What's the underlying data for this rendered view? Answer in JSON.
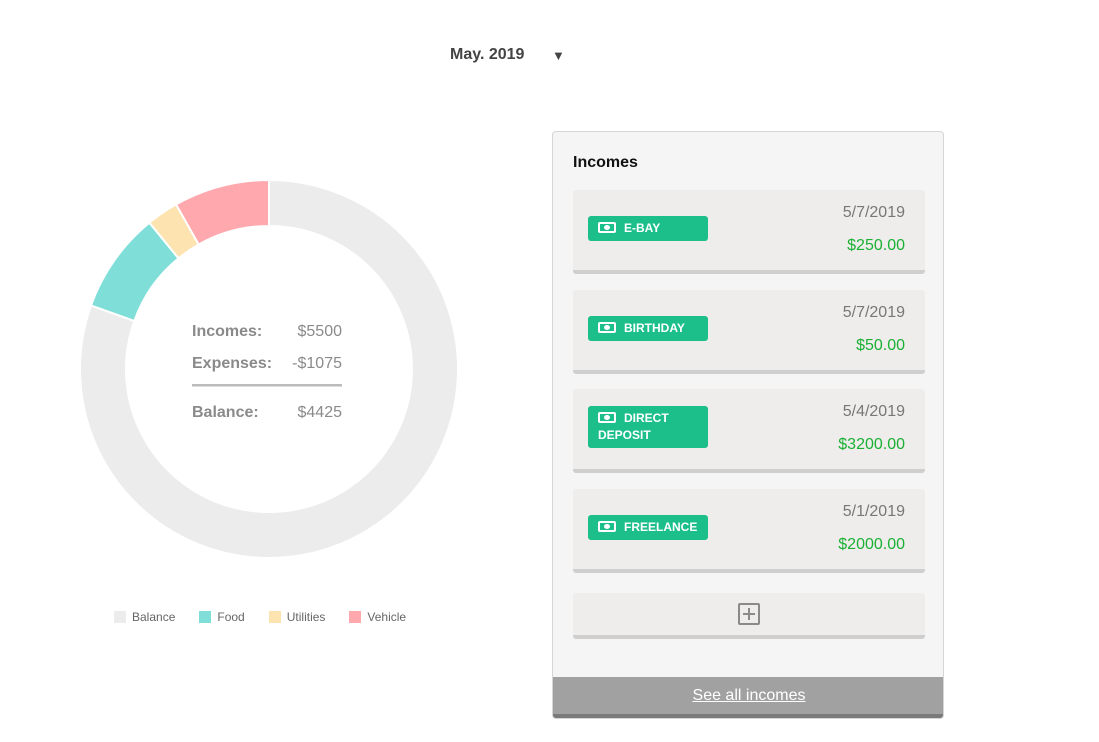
{
  "month_select": {
    "value": "May. 2019"
  },
  "summary": {
    "incomes_label": "Incomes:",
    "incomes_value": "$5500",
    "expenses_label": "Expenses:",
    "expenses_value": "-$1075",
    "balance_label": "Balance:",
    "balance_value": "$4425"
  },
  "chart_data": {
    "type": "pie",
    "categories": [
      "Balance",
      "Food",
      "Utilities",
      "Vehicle"
    ],
    "values": [
      4425,
      475,
      150,
      450
    ],
    "colors": [
      "#ececec",
      "#80ded9",
      "#fde3b0",
      "#ffa8ae"
    ],
    "legend_position": "bottom"
  },
  "incomes_panel": {
    "title": "Incomes",
    "items": [
      {
        "name": "E-BAY",
        "date": "5/7/2019",
        "amount": "$250.00"
      },
      {
        "name": "BIRTHDAY",
        "date": "5/7/2019",
        "amount": "$50.00"
      },
      {
        "name": "DIRECT DEPOSIT",
        "date": "5/4/2019",
        "amount": "$3200.00"
      },
      {
        "name": "FREELANCE",
        "date": "5/1/2019",
        "amount": "$2000.00"
      }
    ],
    "see_all": "See all incomes"
  },
  "colors": {
    "tag_green": "#1cbf8a",
    "amount_green": "#1ab034",
    "footer_gray": "#a1a1a1"
  }
}
